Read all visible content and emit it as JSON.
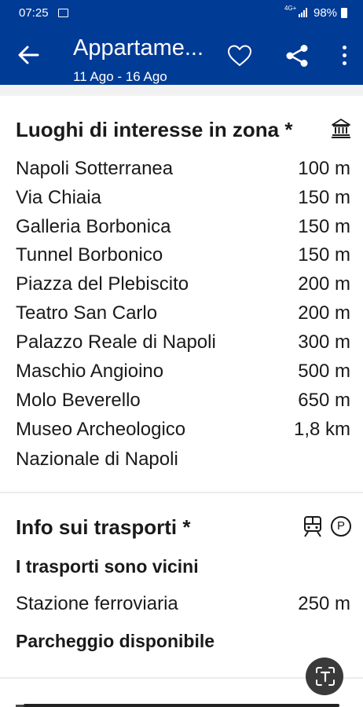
{
  "status_bar": {
    "time": "07:25",
    "network": "4G+",
    "battery": "98%"
  },
  "header": {
    "title": "Appartame...",
    "dates": "11 Ago - 16 Ago",
    "icons": [
      "arrow-back-icon",
      "heart-icon",
      "share-icon",
      "more-vert-icon"
    ]
  },
  "nearby": {
    "heading": "Luoghi di interesse in zona *",
    "icon": "museum-icon",
    "places": [
      {
        "name": "Napoli Sotterranea",
        "distance": "100 m"
      },
      {
        "name": "Via Chiaia",
        "distance": "150 m"
      },
      {
        "name": "Galleria Borbonica",
        "distance": "150 m"
      },
      {
        "name": "Tunnel Borbonico",
        "distance": "150 m"
      },
      {
        "name": "Piazza del Plebiscito",
        "distance": "200 m"
      },
      {
        "name": "Teatro San Carlo",
        "distance": "200 m"
      },
      {
        "name": "Palazzo Reale di Napoli",
        "distance": "300 m"
      },
      {
        "name": "Maschio Angioino",
        "distance": "500 m"
      },
      {
        "name": "Molo Beverello",
        "distance": "650 m"
      },
      {
        "name": "Museo Archeologico",
        "distance": "1,8 km"
      }
    ],
    "last_place_continued": "Nazionale di Napoli"
  },
  "transport": {
    "heading": "Info sui trasporti *",
    "icons": [
      "train-icon",
      "parking-icon"
    ],
    "parking_letter": "P",
    "nearby_label": "I trasporti sono vicini",
    "station": {
      "name": "Stazione ferroviaria",
      "distance": "250 m"
    },
    "parking_label": "Parcheggio disponibile"
  },
  "fab": {
    "icon": "text-scan-icon"
  },
  "colors": {
    "brand": "#003b95",
    "text": "#1a1a1a",
    "fab": "#3a3a3a"
  }
}
